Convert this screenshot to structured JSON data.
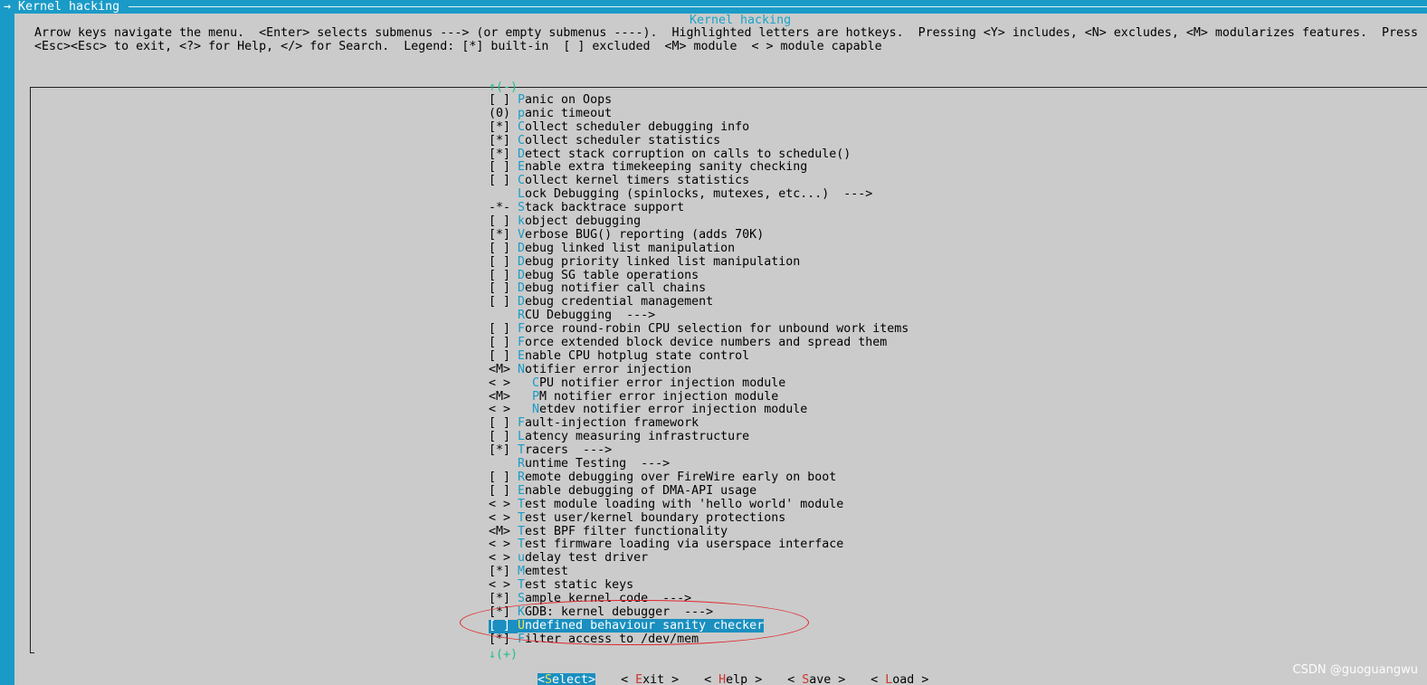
{
  "window": {
    "title": "→ Kernel hacking"
  },
  "dialog": {
    "title": "Kernel hacking",
    "help_line_1": "Arrow keys navigate the menu.  <Enter> selects submenus ---> (or empty submenus ----).  Highlighted letters are hotkeys.  Pressing <Y> includes, <N> excludes, <M> modularizes features.  Press",
    "help_line_2": "<Esc><Esc> to exit, <?> for Help, </> for Search.  Legend: [*] built-in  [ ] excluded  <M> module  < > module capable",
    "scroll_up": "↑(-)",
    "scroll_down": "↓(+)"
  },
  "menu": {
    "items": [
      {
        "mark": "[ ]",
        "hotkey": "P",
        "rest": "anic on Oops"
      },
      {
        "mark": "(0)",
        "hotkey": "p",
        "rest": "anic timeout"
      },
      {
        "mark": "[*]",
        "hotkey": "C",
        "rest": "ollect scheduler debugging info"
      },
      {
        "mark": "[*]",
        "hotkey": "C",
        "rest": "ollect scheduler statistics"
      },
      {
        "mark": "[*]",
        "hotkey": "D",
        "rest": "etect stack corruption on calls to schedule()"
      },
      {
        "mark": "[ ]",
        "hotkey": "E",
        "rest": "nable extra timekeeping sanity checking"
      },
      {
        "mark": "[ ]",
        "hotkey": "C",
        "rest": "ollect kernel timers statistics"
      },
      {
        "mark": "",
        "hotkey": "L",
        "rest": "ock Debugging (spinlocks, mutexes, etc...)  --->"
      },
      {
        "mark": "-*-",
        "hotkey": "S",
        "rest": "tack backtrace support"
      },
      {
        "mark": "[ ]",
        "hotkey": "k",
        "rest": "object debugging"
      },
      {
        "mark": "[*]",
        "hotkey": "V",
        "rest": "erbose BUG() reporting (adds 70K)"
      },
      {
        "mark": "[ ]",
        "hotkey": "D",
        "rest": "ebug linked list manipulation"
      },
      {
        "mark": "[ ]",
        "hotkey": "D",
        "rest": "ebug priority linked list manipulation"
      },
      {
        "mark": "[ ]",
        "hotkey": "D",
        "rest": "ebug SG table operations"
      },
      {
        "mark": "[ ]",
        "hotkey": "D",
        "rest": "ebug notifier call chains"
      },
      {
        "mark": "[ ]",
        "hotkey": "D",
        "rest": "ebug credential management"
      },
      {
        "mark": "",
        "hotkey": "R",
        "rest": "CU Debugging  --->"
      },
      {
        "mark": "[ ]",
        "hotkey": "F",
        "rest": "orce round-robin CPU selection for unbound work items"
      },
      {
        "mark": "[ ]",
        "hotkey": "F",
        "rest": "orce extended block device numbers and spread them"
      },
      {
        "mark": "[ ]",
        "hotkey": "E",
        "rest": "nable CPU hotplug state control"
      },
      {
        "mark": "<M>",
        "hotkey": "N",
        "rest": "otifier error injection"
      },
      {
        "mark": "< >",
        "indent": "  ",
        "hotkey": "C",
        "rest": "PU notifier error injection module"
      },
      {
        "mark": "<M>",
        "indent": "  ",
        "hotkey": "P",
        "rest": "M notifier error injection module"
      },
      {
        "mark": "< >",
        "indent": "  ",
        "hotkey": "N",
        "rest": "etdev notifier error injection module"
      },
      {
        "mark": "[ ]",
        "hotkey": "F",
        "rest": "ault-injection framework"
      },
      {
        "mark": "[ ]",
        "hotkey": "L",
        "rest": "atency measuring infrastructure"
      },
      {
        "mark": "[*]",
        "hotkey": "T",
        "rest": "racers  --->"
      },
      {
        "mark": "",
        "hotkey": "R",
        "rest": "untime Testing  --->"
      },
      {
        "mark": "[ ]",
        "hotkey": "R",
        "rest": "emote debugging over FireWire early on boot"
      },
      {
        "mark": "[ ]",
        "hotkey": "E",
        "rest": "nable debugging of DMA-API usage"
      },
      {
        "mark": "< >",
        "hotkey": "T",
        "rest": "est module loading with 'hello world' module"
      },
      {
        "mark": "< >",
        "hotkey": "T",
        "rest": "est user/kernel boundary protections"
      },
      {
        "mark": "<M>",
        "hotkey": "T",
        "rest": "est BPF filter functionality"
      },
      {
        "mark": "< >",
        "hotkey": "T",
        "rest": "est firmware loading via userspace interface"
      },
      {
        "mark": "< >",
        "hotkey": "u",
        "rest": "delay test driver"
      },
      {
        "mark": "[*]",
        "hotkey": "M",
        "rest": "emtest"
      },
      {
        "mark": "< >",
        "hotkey": "T",
        "rest": "est static keys"
      },
      {
        "mark": "[*]",
        "hotkey": "S",
        "rest": "ample kernel code  --->"
      },
      {
        "mark": "[*]",
        "hotkey": "K",
        "rest": "GDB: kernel debugger  --->"
      },
      {
        "mark": "[ ]",
        "hotkey": "U",
        "rest": "ndefined behaviour sanity checker",
        "selected": true
      },
      {
        "mark": "[*]",
        "hotkey": "F",
        "rest": "ilter access to /dev/mem"
      }
    ]
  },
  "buttons": [
    {
      "pre": "<",
      "hotkey": "S",
      "rest": "elect>",
      "active": true
    },
    {
      "pre": "< ",
      "hotkey": "E",
      "rest": "xit >",
      "active": false
    },
    {
      "pre": "< ",
      "hotkey": "H",
      "rest": "elp >",
      "active": false
    },
    {
      "pre": "< ",
      "hotkey": "S",
      "rest": "ave >",
      "active": false
    },
    {
      "pre": "< ",
      "hotkey": "L",
      "rest": "oad >",
      "active": false
    }
  ],
  "watermark": "CSDN @guoguangwu",
  "colors": {
    "background": "#1a9bc7",
    "dialog": "#cbcbcb",
    "hotkey": "#1a9bc7",
    "selected_bg": "#1a8fc0",
    "selected_hotkey": "#f1e05a",
    "button_hotkey": "#d2322d",
    "annotation": "#e0262a"
  }
}
